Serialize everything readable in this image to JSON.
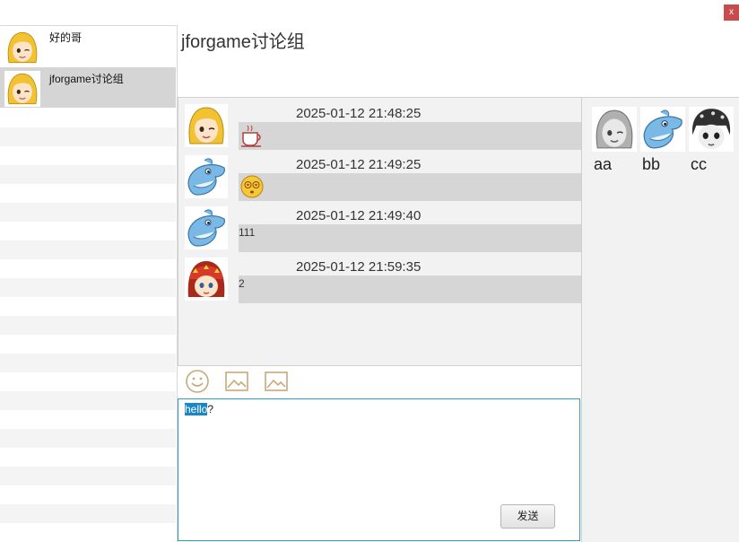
{
  "window": {
    "close_label": "x"
  },
  "contacts": [
    {
      "name": "好的哥",
      "avatar": "blonde-girl-avatar",
      "selected": false
    },
    {
      "name": "jforgame讨论组",
      "avatar": "blonde-girl-avatar",
      "selected": true
    }
  ],
  "chat": {
    "title": "jforgame讨论组",
    "messages": [
      {
        "time": "2025-01-12 21:48:25",
        "avatar": "blonde-girl-avatar",
        "content_type": "emoji",
        "emoji": "coffee-cup-icon",
        "text": ""
      },
      {
        "time": "2025-01-12 21:49:25",
        "avatar": "dolphin-avatar",
        "content_type": "emoji",
        "emoji": "dizzy-face-icon",
        "text": ""
      },
      {
        "time": "2025-01-12 21:49:40",
        "avatar": "dolphin-avatar",
        "content_type": "text",
        "text": "111"
      },
      {
        "time": "2025-01-12 21:59:35",
        "avatar": "red-bandana-boy-avatar",
        "content_type": "text",
        "text": "2"
      }
    ]
  },
  "toolbar": {
    "icons": [
      "smiley-icon",
      "image-icon",
      "image-icon"
    ]
  },
  "input": {
    "selected_text": "hello",
    "rest_text": "?",
    "send_label": "发送"
  },
  "members": [
    {
      "name": "aa",
      "avatar": "gray-girl-avatar"
    },
    {
      "name": "bb",
      "avatar": "dolphin-avatar"
    },
    {
      "name": "cc",
      "avatar": "dark-hair-boy-avatar"
    }
  ]
}
